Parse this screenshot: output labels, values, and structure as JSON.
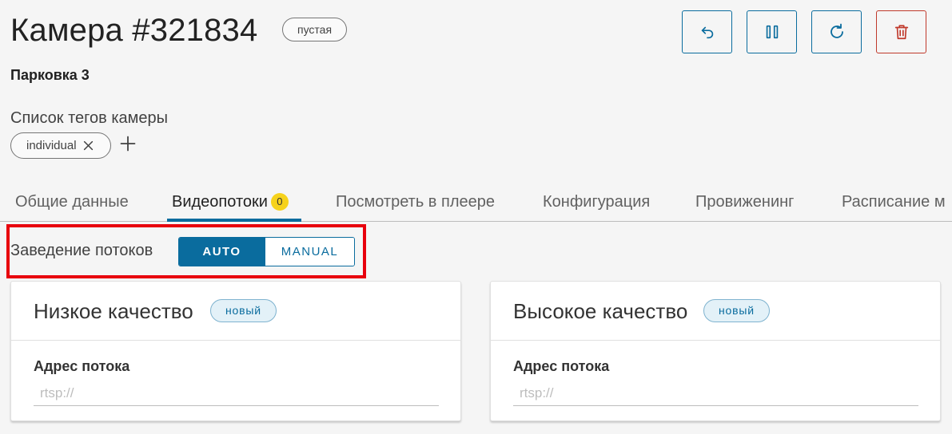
{
  "header": {
    "title": "Камера #321834",
    "status": "пустая",
    "subtitle": "Парковка 3",
    "actions": [
      {
        "name": "undo-button",
        "icon": "undo-icon"
      },
      {
        "name": "pause-button",
        "icon": "pause-icon"
      },
      {
        "name": "refresh-button",
        "icon": "refresh-icon"
      },
      {
        "name": "delete-button",
        "icon": "trash-icon"
      }
    ]
  },
  "tags": {
    "label": "Список тегов камеры",
    "items": [
      "individual"
    ]
  },
  "tabs": {
    "items": [
      {
        "label": "Общие данные"
      },
      {
        "label": "Видеопотоки",
        "badge": "0",
        "active": true
      },
      {
        "label": "Посмотреть в плеере"
      },
      {
        "label": "Конфигурация"
      },
      {
        "label": "Провиженинг"
      },
      {
        "label": "Расписание м"
      }
    ]
  },
  "streams_mode": {
    "label": "Заведение потоков",
    "options": [
      "AUTO",
      "MANUAL"
    ],
    "selected": "AUTO"
  },
  "cards": [
    {
      "title": "Низкое качество",
      "badge": "новый",
      "field_label": "Адрес потока",
      "placeholder": "rtsp://"
    },
    {
      "title": "Высокое качество",
      "badge": "новый",
      "field_label": "Адрес потока",
      "placeholder": "rtsp://"
    }
  ],
  "colors": {
    "accent": "#0a6c9e",
    "danger": "#c0392b",
    "highlight": "#e8000d",
    "badge": "#f6d21c"
  }
}
